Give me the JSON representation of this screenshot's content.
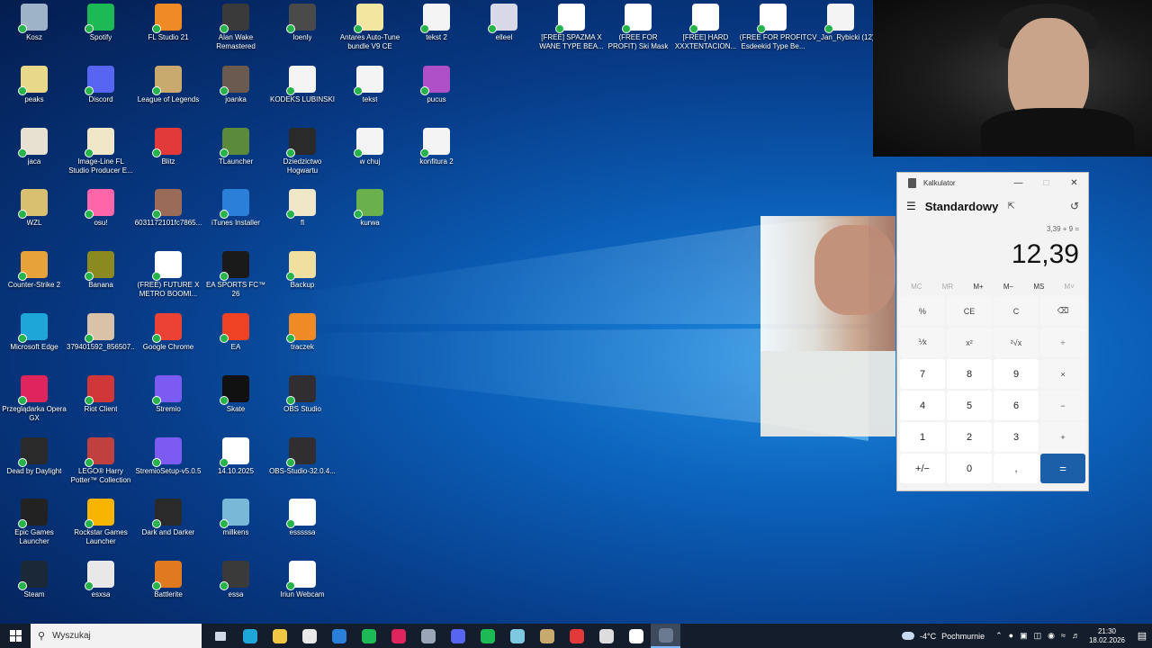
{
  "desktop": {
    "icons": [
      {
        "label": "Kosz",
        "color": "#9fb3c8",
        "glyph": ""
      },
      {
        "label": "peaks",
        "color": "#e8d98a",
        "glyph": ""
      },
      {
        "label": "jaca",
        "color": "#e8e0d0",
        "glyph": ""
      },
      {
        "label": "WZL",
        "color": "#d8c070",
        "glyph": ""
      },
      {
        "label": "Counter-Strike 2",
        "color": "#e7a23a",
        "glyph": ""
      },
      {
        "label": "Microsoft Edge",
        "color": "#1ea6d8",
        "glyph": ""
      },
      {
        "label": "Przeglądarka Opera GX",
        "color": "#e0245e",
        "glyph": ""
      },
      {
        "label": "Dead by Daylight",
        "color": "#2a2a2a",
        "glyph": ""
      },
      {
        "label": "Epic Games Launcher",
        "color": "#222222",
        "glyph": ""
      },
      {
        "label": "Steam",
        "color": "#1b2838",
        "glyph": ""
      },
      {
        "label": "Spotify",
        "color": "#1db954",
        "glyph": ""
      },
      {
        "label": "Discord",
        "color": "#5865f2",
        "glyph": ""
      },
      {
        "label": "Image-Line FL Studio Producer E...",
        "color": "#f0e6c8",
        "glyph": ""
      },
      {
        "label": "osu!",
        "color": "#ff66aa",
        "glyph": ""
      },
      {
        "label": "Banana",
        "color": "#8a8a20",
        "glyph": ""
      },
      {
        "label": "379401592_856507...",
        "color": "#d8c2a8",
        "glyph": ""
      },
      {
        "label": "Riot Client",
        "color": "#d13639",
        "glyph": ""
      },
      {
        "label": "LEGO® Harry Potter™ Collection",
        "color": "#c04040",
        "glyph": ""
      },
      {
        "label": "Rockstar Games Launcher",
        "color": "#f7b500",
        "glyph": ""
      },
      {
        "label": "esxsa",
        "color": "#e8e8e8",
        "glyph": ""
      },
      {
        "label": "FL Studio 21",
        "color": "#f08a24",
        "glyph": ""
      },
      {
        "label": "League of Legends",
        "color": "#c8aa6e",
        "glyph": ""
      },
      {
        "label": "Blitz",
        "color": "#e23a3a",
        "glyph": ""
      },
      {
        "label": "60311721​01fc7865...",
        "color": "#9b6b5a",
        "glyph": ""
      },
      {
        "label": "(FREE) FUTURE X METRO BOOMI...",
        "color": "#ffffff",
        "glyph": ""
      },
      {
        "label": "Google Chrome",
        "color": "#ea4335",
        "glyph": ""
      },
      {
        "label": "Stremio",
        "color": "#7b5bf2",
        "glyph": ""
      },
      {
        "label": "StremioSetup-v5.0.5",
        "color": "#7b5bf2",
        "glyph": ""
      },
      {
        "label": "Dark and Darker",
        "color": "#2a2a2a",
        "glyph": ""
      },
      {
        "label": "Battlerite",
        "color": "#e07a20",
        "glyph": ""
      },
      {
        "label": "Alan Wake Remastered",
        "color": "#3a3a3a",
        "glyph": ""
      },
      {
        "label": "joanka",
        "color": "#6b5a50",
        "glyph": ""
      },
      {
        "label": "TLauncher",
        "color": "#5a8a3a",
        "glyph": ""
      },
      {
        "label": "iTunes Installer",
        "color": "#2a7fd8",
        "glyph": ""
      },
      {
        "label": "EA SPORTS FC™ 26",
        "color": "#1a1a1a",
        "glyph": ""
      },
      {
        "label": "EA",
        "color": "#ef4123",
        "glyph": ""
      },
      {
        "label": "Skate",
        "color": "#111111",
        "glyph": ""
      },
      {
        "label": "14.10.2025",
        "color": "#ffffff",
        "glyph": ""
      },
      {
        "label": "millkens",
        "color": "#7ab8d8",
        "glyph": ""
      },
      {
        "label": "essa",
        "color": "#3a3a3a",
        "glyph": ""
      },
      {
        "label": "loenly",
        "color": "#4a4a4a",
        "glyph": ""
      },
      {
        "label": "KODEKS LUBINSKI",
        "color": "#f4f4f4",
        "glyph": ""
      },
      {
        "label": "Dziedzictwo Hogwartu",
        "color": "#2a2a2a",
        "glyph": ""
      },
      {
        "label": "fl",
        "color": "#f0e6c8",
        "glyph": ""
      },
      {
        "label": "Backup",
        "color": "#f0e0a0",
        "glyph": ""
      },
      {
        "label": "traczek",
        "color": "#f08a24",
        "glyph": ""
      },
      {
        "label": "OBS Studio",
        "color": "#302e31",
        "glyph": ""
      },
      {
        "label": "OBS-Studio-32.0.4...",
        "color": "#302e31",
        "glyph": ""
      },
      {
        "label": "esssssa",
        "color": "#ffffff",
        "glyph": ""
      },
      {
        "label": "Iriun Webcam",
        "color": "#ffffff",
        "glyph": ""
      },
      {
        "label": "Antares Auto-Tune bundle V9 CE",
        "color": "#f2e6a0",
        "glyph": ""
      },
      {
        "label": "tekst",
        "color": "#f4f4f4",
        "glyph": ""
      },
      {
        "label": "w chuj",
        "color": "#f4f4f4",
        "glyph": ""
      },
      {
        "label": "kurwa",
        "color": "#6ab04c",
        "glyph": ""
      },
      {
        "label": "tekst 2",
        "color": "#f4f4f4",
        "glyph": ""
      },
      {
        "label": "pucus",
        "color": "#b050c8",
        "glyph": ""
      },
      {
        "label": "konfitura 2",
        "color": "#f4f4f4",
        "glyph": ""
      },
      {
        "label": "elleel",
        "color": "#d8d8e8",
        "glyph": ""
      },
      {
        "label": "[FREE] SPAZMA X WANE TYPE BEA...",
        "color": "#ffffff",
        "glyph": ""
      },
      {
        "label": "(FREE FOR PROFIT) Ski Mask The Slu...",
        "color": "#ffffff",
        "glyph": ""
      },
      {
        "label": "[FREE] HARD XXXTENTACION...",
        "color": "#ffffff",
        "glyph": ""
      },
      {
        "label": "(FREE FOR PROFIT Esdeekid Type Be...",
        "color": "#ffffff",
        "glyph": ""
      },
      {
        "label": "CV_Jan_Rybicki (12)",
        "color": "#f4f4f4",
        "glyph": ""
      }
    ]
  },
  "calculator": {
    "title": "Kalkulator",
    "mode": "Standardowy",
    "expression": "3,39 + 9 =",
    "display": "12,39",
    "memory": [
      "MC",
      "MR",
      "M+",
      "M−",
      "MS",
      "M˅"
    ],
    "keys": [
      "%",
      "CE",
      "C",
      "⌫",
      "⅟x",
      "x²",
      "²√x",
      "÷",
      "7",
      "8",
      "9",
      "×",
      "4",
      "5",
      "6",
      "−",
      "1",
      "2",
      "3",
      "+",
      "+/−",
      "0",
      ",",
      "="
    ]
  },
  "taskbar": {
    "search_placeholder": "Wyszukaj",
    "temperature": "-4°C",
    "weather": "Pochmurnie",
    "time": "21:30",
    "date": "18.02.2026",
    "apps": [
      {
        "name": "task-view",
        "color": "#cfd8e6"
      },
      {
        "name": "edge",
        "color": "#1ea6d8"
      },
      {
        "name": "file-explorer",
        "color": "#f2c744"
      },
      {
        "name": "store",
        "color": "#e8e8e8"
      },
      {
        "name": "mail",
        "color": "#2a7fd8"
      },
      {
        "name": "spotify",
        "color": "#1db954"
      },
      {
        "name": "opera-gx",
        "color": "#e0245e"
      },
      {
        "name": "steam-like",
        "color": "#9aa6b8"
      },
      {
        "name": "discord",
        "color": "#5865f2"
      },
      {
        "name": "spotify-2",
        "color": "#1db954"
      },
      {
        "name": "notepad",
        "color": "#7ec8e0"
      },
      {
        "name": "league",
        "color": "#c8aa6e"
      },
      {
        "name": "blitz",
        "color": "#e23a3a"
      },
      {
        "name": "obs",
        "color": "#dddddd"
      },
      {
        "name": "iriun",
        "color": "#ffffff"
      },
      {
        "name": "calculator",
        "color": "#6a7a90"
      }
    ]
  }
}
